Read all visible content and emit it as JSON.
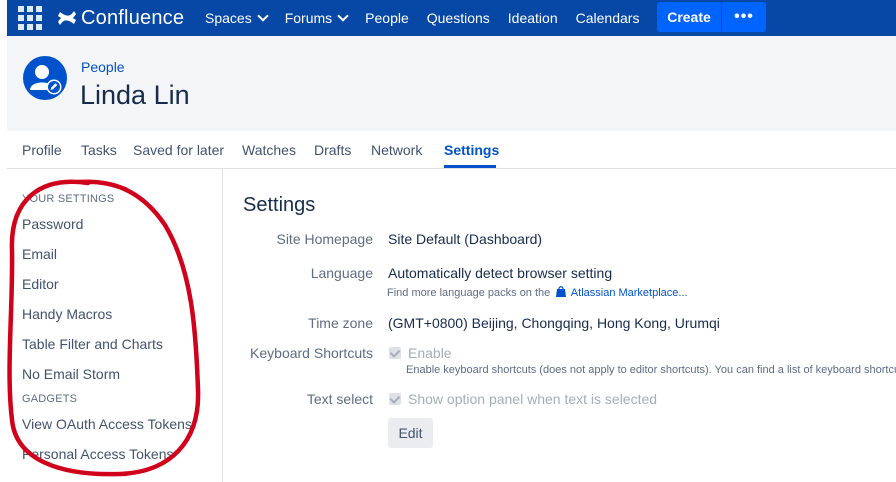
{
  "topnav": {
    "logo_text": "Confluence",
    "items": [
      {
        "label": "Spaces",
        "dropdown": true
      },
      {
        "label": "Forums",
        "dropdown": true
      },
      {
        "label": "People",
        "dropdown": false
      },
      {
        "label": "Questions",
        "dropdown": false
      },
      {
        "label": "Ideation",
        "dropdown": false
      },
      {
        "label": "Calendars",
        "dropdown": false
      }
    ],
    "create_label": "Create",
    "more_label": "•••",
    "bar_color": "#0747A6",
    "button_color": "#0065FF"
  },
  "header": {
    "breadcrumb": "People",
    "title": "Linda Lin"
  },
  "tabs": [
    {
      "label": "Profile"
    },
    {
      "label": "Tasks"
    },
    {
      "label": "Saved for later"
    },
    {
      "label": "Watches"
    },
    {
      "label": "Drafts"
    },
    {
      "label": "Network"
    },
    {
      "label": "Settings",
      "active": true
    }
  ],
  "sidebar": {
    "section1": "YOUR SETTINGS",
    "items1": [
      "Password",
      "Email",
      "Editor",
      "Handy Macros",
      "Table Filter and Charts",
      "No Email Storm"
    ],
    "section2": "GADGETS",
    "items2": [
      "View OAuth Access Tokens",
      "Personal Access Tokens"
    ]
  },
  "settings": {
    "title": "Settings",
    "site_homepage_label": "Site Homepage",
    "site_homepage_value": "Site Default (Dashboard)",
    "language_label": "Language",
    "language_value": "Automatically detect browser setting",
    "language_hint_prefix": "Find more language packs on the",
    "language_hint_link": "Atlassian Marketplace...",
    "timezone_label": "Time zone",
    "timezone_value": "(GMT+0800) Beijing, Chongqing, Hong Kong, Urumqi",
    "shortcuts_label": "Keyboard Shortcuts",
    "shortcuts_checkbox": "Enable",
    "shortcuts_hint": "Enable keyboard shortcuts (does not apply to editor shortcuts). You can find a list of keyboard shortcuts",
    "textselect_label": "Text select",
    "textselect_checkbox": "Show option panel when text is selected",
    "edit_label": "Edit"
  },
  "annotation_color": "#D0021B"
}
